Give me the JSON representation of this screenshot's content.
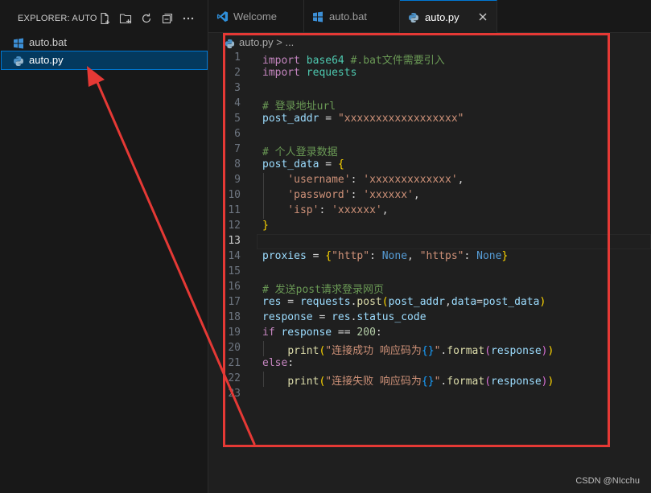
{
  "sidebar": {
    "title": "EXPLORER: AUTO",
    "actions": [
      {
        "name": "new-file",
        "icon": "new-file-icon"
      },
      {
        "name": "new-folder",
        "icon": "new-folder-icon"
      },
      {
        "name": "refresh",
        "icon": "refresh-icon"
      },
      {
        "name": "collapse-all",
        "icon": "collapse-all-icon"
      },
      {
        "name": "more",
        "icon": "more-icon"
      }
    ],
    "files": [
      {
        "name": "auto.bat",
        "icon": "windows-icon",
        "selected": false
      },
      {
        "name": "auto.py",
        "icon": "python-icon",
        "selected": true
      }
    ]
  },
  "tabs": [
    {
      "label": "Welcome",
      "icon": "vscode-icon",
      "active": false
    },
    {
      "label": "auto.bat",
      "icon": "windows-icon",
      "active": false
    },
    {
      "label": "auto.py",
      "icon": "python-icon",
      "active": true,
      "close": "close-icon"
    }
  ],
  "breadcrumb": "auto.py > ...",
  "editor": {
    "active_line": 13,
    "lines": [
      {
        "n": "1",
        "tokens": [
          [
            "kw",
            "import"
          ],
          [
            "op",
            " "
          ],
          [
            "mod",
            "base64"
          ],
          [
            "op",
            " "
          ],
          [
            "cm",
            "#.bat文件需要引入"
          ]
        ]
      },
      {
        "n": "2",
        "tokens": [
          [
            "kw",
            "import"
          ],
          [
            "op",
            " "
          ],
          [
            "mod",
            "requests"
          ]
        ]
      },
      {
        "n": "3",
        "tokens": []
      },
      {
        "n": "4",
        "tokens": [
          [
            "cm",
            "# 登录地址url"
          ]
        ]
      },
      {
        "n": "5",
        "tokens": [
          [
            "var",
            "post_addr"
          ],
          [
            "op",
            " = "
          ],
          [
            "str",
            "\"xxxxxxxxxxxxxxxxxx\""
          ]
        ]
      },
      {
        "n": "6",
        "tokens": []
      },
      {
        "n": "7",
        "tokens": [
          [
            "cm",
            "# 个人登录数据"
          ]
        ]
      },
      {
        "n": "8",
        "tokens": [
          [
            "var",
            "post_data"
          ],
          [
            "op",
            " = "
          ],
          [
            "br1",
            "{"
          ]
        ]
      },
      {
        "n": "9",
        "tokens": [
          [
            "op",
            "    "
          ],
          [
            "str",
            "'username'"
          ],
          [
            "op",
            ": "
          ],
          [
            "str",
            "'xxxxxxxxxxxxx'"
          ],
          [
            "op",
            ","
          ]
        ]
      },
      {
        "n": "10",
        "tokens": [
          [
            "op",
            "    "
          ],
          [
            "str",
            "'password'"
          ],
          [
            "op",
            ": "
          ],
          [
            "str",
            "'xxxxxx'"
          ],
          [
            "op",
            ","
          ]
        ]
      },
      {
        "n": "11",
        "tokens": [
          [
            "op",
            "    "
          ],
          [
            "str",
            "'isp'"
          ],
          [
            "op",
            ": "
          ],
          [
            "str",
            "'xxxxxx'"
          ],
          [
            "op",
            ","
          ]
        ]
      },
      {
        "n": "12",
        "tokens": [
          [
            "br1",
            "}"
          ]
        ]
      },
      {
        "n": "13",
        "tokens": []
      },
      {
        "n": "14",
        "tokens": [
          [
            "var",
            "proxies"
          ],
          [
            "op",
            " = "
          ],
          [
            "br1",
            "{"
          ],
          [
            "str",
            "\"http\""
          ],
          [
            "op",
            ": "
          ],
          [
            "const",
            "None"
          ],
          [
            "op",
            ", "
          ],
          [
            "str",
            "\"https\""
          ],
          [
            "op",
            ": "
          ],
          [
            "const",
            "None"
          ],
          [
            "br1",
            "}"
          ]
        ]
      },
      {
        "n": "15",
        "tokens": []
      },
      {
        "n": "16",
        "tokens": [
          [
            "cm",
            "# 发送post请求登录网页"
          ]
        ]
      },
      {
        "n": "17",
        "tokens": [
          [
            "var",
            "res"
          ],
          [
            "op",
            " = "
          ],
          [
            "var",
            "requests"
          ],
          [
            "op",
            "."
          ],
          [
            "fn",
            "post"
          ],
          [
            "br1",
            "("
          ],
          [
            "var",
            "post_addr"
          ],
          [
            "op",
            ","
          ],
          [
            "var",
            "data"
          ],
          [
            "op",
            "="
          ],
          [
            "var",
            "post_data"
          ],
          [
            "br1",
            ")"
          ]
        ]
      },
      {
        "n": "18",
        "tokens": [
          [
            "var",
            "response"
          ],
          [
            "op",
            " = "
          ],
          [
            "var",
            "res"
          ],
          [
            "op",
            "."
          ],
          [
            "var",
            "status_code"
          ]
        ]
      },
      {
        "n": "19",
        "tokens": [
          [
            "kw",
            "if"
          ],
          [
            "op",
            " "
          ],
          [
            "var",
            "response"
          ],
          [
            "op",
            " == "
          ],
          [
            "num",
            "200"
          ],
          [
            "op",
            ":"
          ]
        ]
      },
      {
        "n": "20",
        "tokens": [
          [
            "op",
            "    "
          ],
          [
            "fn",
            "print"
          ],
          [
            "br1",
            "("
          ],
          [
            "str",
            "\"连接成功 响应码为"
          ],
          [
            "br3",
            "{}"
          ],
          [
            "str",
            "\""
          ],
          [
            "op",
            "."
          ],
          [
            "fn",
            "format"
          ],
          [
            "br2",
            "("
          ],
          [
            "var",
            "response"
          ],
          [
            "br2",
            ")"
          ],
          [
            "br1",
            ")"
          ]
        ]
      },
      {
        "n": "21",
        "tokens": [
          [
            "kw",
            "else"
          ],
          [
            "op",
            ":"
          ]
        ]
      },
      {
        "n": "22",
        "tokens": [
          [
            "op",
            "    "
          ],
          [
            "fn",
            "print"
          ],
          [
            "br1",
            "("
          ],
          [
            "str",
            "\"连接失败 响应码为"
          ],
          [
            "br3",
            "{}"
          ],
          [
            "str",
            "\""
          ],
          [
            "op",
            "."
          ],
          [
            "fn",
            "format"
          ],
          [
            "br2",
            "("
          ],
          [
            "var",
            "response"
          ],
          [
            "br2",
            ")"
          ],
          [
            "br1",
            ")"
          ]
        ]
      },
      {
        "n": "23",
        "tokens": []
      }
    ]
  },
  "watermark": "CSDN @NIcchu",
  "colors": {
    "annotation": "#e53935",
    "accent": "#0078d4",
    "selection": "#04395e"
  }
}
